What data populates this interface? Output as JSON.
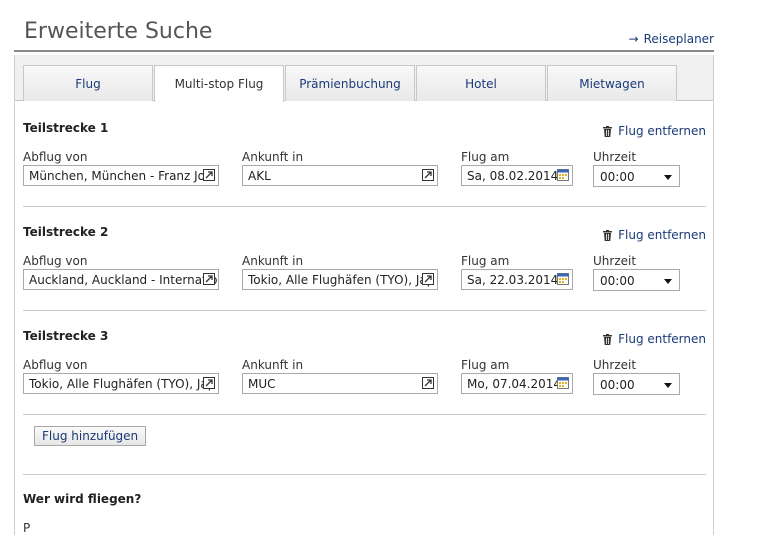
{
  "header": {
    "title": "Erweiterte Suche",
    "planner_link": "Reiseplaner"
  },
  "tabs": [
    {
      "label": "Flug",
      "active": false
    },
    {
      "label": "Multi-stop Flug",
      "active": true
    },
    {
      "label": "Prämienbuchung",
      "active": false
    },
    {
      "label": "Hotel",
      "active": false
    },
    {
      "label": "Mietwagen",
      "active": false
    }
  ],
  "labels": {
    "from": "Abflug von",
    "to": "Ankunft in",
    "date": "Flug am",
    "time": "Uhrzeit",
    "remove": "Flug entfernen"
  },
  "legs": [
    {
      "title": "Teilstrecke 1",
      "from": "München, München - Franz Jos",
      "to": "AKL",
      "date": "Sa, 08.02.2014",
      "time": "00:00"
    },
    {
      "title": "Teilstrecke 2",
      "from": "Auckland, Auckland - Internatior",
      "to": "Tokio, Alle Flughäfen (TYO), Jap",
      "date": "Sa, 22.03.2014",
      "time": "00:00"
    },
    {
      "title": "Teilstrecke 3",
      "from": "Tokio, Alle Flughäfen (TYO), Jap",
      "to": "MUC",
      "date": "Mo, 07.04.2014",
      "time": "00:00"
    }
  ],
  "add_flight": "Flug hinzufügen",
  "travelers": {
    "title": "Wer wird fliegen?",
    "partial_label": "P"
  },
  "colors": {
    "link": "#1a3a78",
    "tab_bg": "#f0f0f0",
    "border": "#cccccc"
  }
}
